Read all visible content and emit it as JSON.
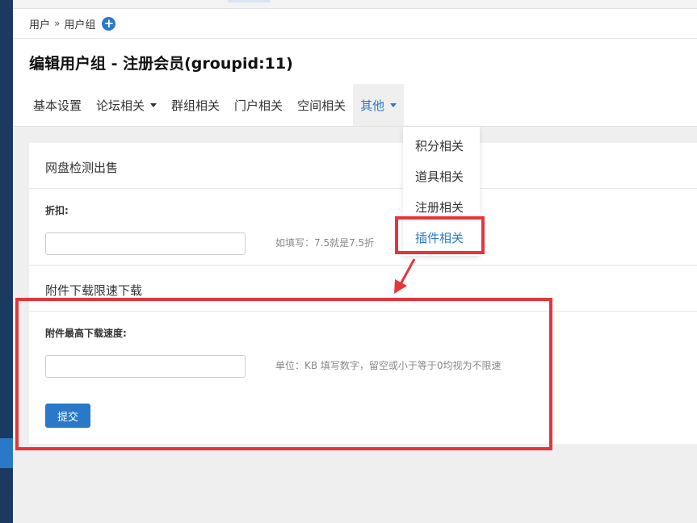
{
  "breadcrumb": {
    "item1": "用户",
    "separator": "»",
    "item2": "用户组",
    "add_icon": "plus-circle-icon"
  },
  "page_title": "编辑用户组 - 注册会员(groupid:11)",
  "tabs": [
    {
      "label": "基本设置",
      "dropdown": false
    },
    {
      "label": "论坛相关",
      "dropdown": true
    },
    {
      "label": "群组相关",
      "dropdown": false
    },
    {
      "label": "门户相关",
      "dropdown": false
    },
    {
      "label": "空间相关",
      "dropdown": false
    },
    {
      "label": "其他",
      "dropdown": true,
      "active": true
    }
  ],
  "dropdown_menu": {
    "items": [
      "积分相关",
      "道具相关",
      "注册相关",
      "插件相关"
    ],
    "current": "插件相关"
  },
  "sections": {
    "netdisk": {
      "title": "网盘检测出售",
      "field_label": "折扣:",
      "value": "",
      "hint": "如填写：7.5就是7.5折"
    },
    "attachment": {
      "title": "附件下载限速下载",
      "field_label": "附件最高下载速度:",
      "value": "",
      "hint": "单位：KB 填写数字，留空或小于等于0均视为不限速"
    }
  },
  "submit_label": "提交",
  "colors": {
    "accent": "#2a78c8",
    "sidebar": "#1b3a61",
    "annotation": "#e5353b"
  }
}
